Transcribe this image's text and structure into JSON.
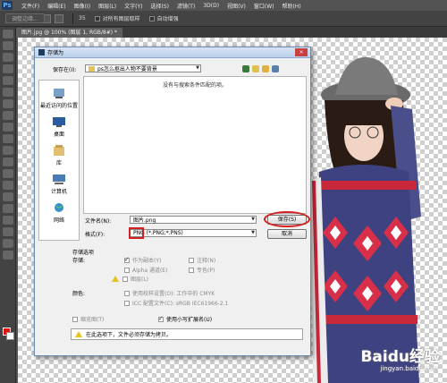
{
  "app": {
    "logo": "Ps",
    "menu": [
      "文件(F)",
      "编辑(E)",
      "图像(I)",
      "图层(L)",
      "文字(Y)",
      "选择(S)",
      "滤镜(T)",
      "3D(D)",
      "视图(V)",
      "窗口(W)",
      "帮助(H)"
    ]
  },
  "options": {
    "size": "35",
    "sample_all": "对所有图层取样",
    "auto_enhance": "自动增强",
    "refine_edge": "调整边缘..."
  },
  "document_tab": "图片.jpg @ 100% (图层 1, RGB/8#) *",
  "dialog": {
    "title": "存储为",
    "close": "×",
    "save_in_label": "保存在(I):",
    "save_in_value": "ps怎么抠出人物不要背景",
    "places": [
      "最近访问的位置",
      "桌面",
      "库",
      "计算机",
      "网络"
    ],
    "empty_message": "没有与搜索条件匹配的项。",
    "filename_label": "文件名(N):",
    "filename_value": "图片.png",
    "format_label": "格式(F):",
    "format_value": "PNG (*.PNG;*.PNS)",
    "save_button": "保存(S)",
    "cancel_button": "取消",
    "save_options_title": "存储选项",
    "save_label": "存储:",
    "as_copy": "作为副本(Y)",
    "notes": "注释(N)",
    "alpha": "Alpha 通道(E)",
    "spot": "专色(P)",
    "layers": "图层(L)",
    "color_label": "颜色:",
    "proof": "使用校样设置(O): 工作中的 CMYK",
    "icc": "ICC 配置文件(C): sRGB IEC61966-2.1",
    "thumbnail": "缩览图(T)",
    "lowercase": "使用小写扩展名(U)",
    "status": "在此选项下，文件必须存储为拷贝。"
  },
  "watermark": {
    "brand": "Baidu经验",
    "url": "jingyan.baidu.com"
  },
  "colors": {
    "accent_red": "#d42020",
    "foreground_swatch": "#e01010"
  }
}
